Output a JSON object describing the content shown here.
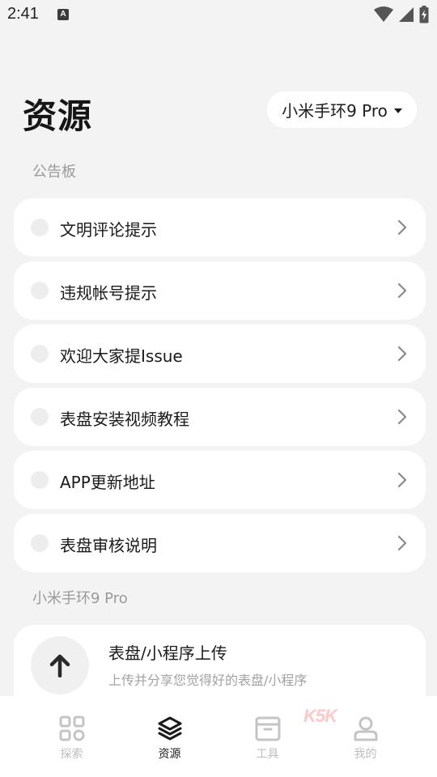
{
  "status_bar": {
    "time": "2:41",
    "notification_icon": "A",
    "icons": [
      "wifi-icon",
      "cellular-signal-icon",
      "battery-charging-icon"
    ]
  },
  "header": {
    "title": "资源",
    "device_selector": "小米手环9 Pro"
  },
  "notice_board": {
    "label": "公告板",
    "items": [
      {
        "label": "文明评论提示"
      },
      {
        "label": "违规帐号提示"
      },
      {
        "label": "欢迎大家提Issue"
      },
      {
        "label": "表盘安装视频教程"
      },
      {
        "label": "APP更新地址"
      },
      {
        "label": "表盘审核说明"
      }
    ]
  },
  "device_section": {
    "label": "小米手环9 Pro",
    "upload": {
      "title": "表盘/小程序上传",
      "subtitle": "上传并分享您觉得好的表盘/小程序",
      "icon": "arrow-up-icon"
    }
  },
  "bottom_nav": {
    "items": [
      {
        "label": "探索",
        "icon": "grid-icon",
        "active": false
      },
      {
        "label": "资源",
        "icon": "layers-icon",
        "active": true
      },
      {
        "label": "工具",
        "icon": "archive-box-icon",
        "active": false
      },
      {
        "label": "我的",
        "icon": "user-icon",
        "active": false
      }
    ]
  },
  "watermark": "K5K",
  "colors": {
    "background": "#f3f3f3",
    "card": "#ffffff",
    "text_primary": "#1a1a1a",
    "text_secondary": "#9a9a9a",
    "nav_inactive": "#bdbdbd"
  }
}
